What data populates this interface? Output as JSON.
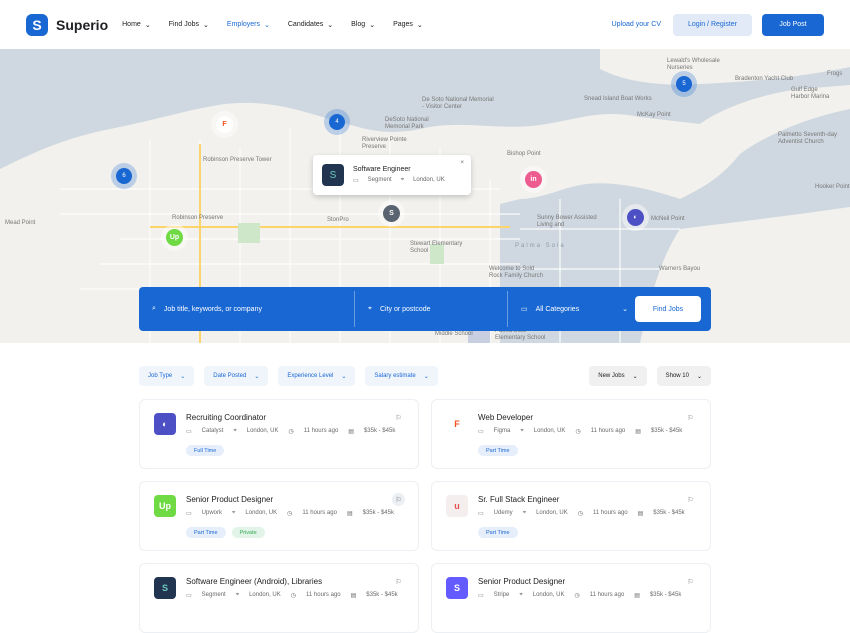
{
  "header": {
    "logo_text": "Superio",
    "nav": [
      "Home",
      "Find Jobs",
      "Employers",
      "Candidates",
      "Blog",
      "Pages"
    ],
    "upload": "Upload your CV",
    "login": "Login / Register",
    "job_post": "Job Post"
  },
  "map": {
    "labels": [
      "Mead Point",
      "Robinson Preserve Tower",
      "Robinson Preserve",
      "De Soto National Memorial - Visitor Center",
      "DeSoto National Memorial Park",
      "Riverview Pointe Preserve",
      "Bishop Point",
      "Sunny Bower Assisted Living and",
      "Palma Sola",
      "Stewart Elementary School",
      "Welcome to Sold Rock Family Church",
      "StonPro",
      "McKay Point",
      "Snead Island Boat Works",
      "Lewald's Wholesale Nurseries",
      "Bradenton Yacht Club",
      "Gulf Edge Harbor Marina",
      "Palmetto Seventh-day Adventist Church",
      "Hooker Point",
      "McNeil Point",
      "Warners Bayou",
      "Middle School",
      "Palma Sola Elementary School",
      "Frogs"
    ],
    "clusters": [
      "6",
      "4",
      "5"
    ],
    "popup": {
      "title": "Software Engineer",
      "company": "Segment",
      "location": "London, UK",
      "close": "×"
    }
  },
  "search": {
    "keyword_placeholder": "Job title, keywords, or company",
    "location_placeholder": "City or postcode",
    "category": "All Categories",
    "button": "Find Jobs"
  },
  "filters": [
    "Job Type",
    "Date Posted",
    "Experience Level",
    "Salary estimate"
  ],
  "sort": [
    "New Jobs",
    "Show 10"
  ],
  "jobs": [
    {
      "title": "Recruiting Coordinator",
      "company": "Catalyst",
      "location": "London, UK",
      "time": "11 hours ago",
      "salary": "$35k - $45k",
      "tags": [
        "Full Time"
      ]
    },
    {
      "title": "Web Developer",
      "company": "Figma",
      "location": "London, UK",
      "time": "11 hours ago",
      "salary": "$35k - $45k",
      "tags": [
        "Part Time"
      ]
    },
    {
      "title": "Senior Product Designer",
      "company": "Upwork",
      "location": "London, UK",
      "time": "11 hours ago",
      "salary": "$35k - $45k",
      "tags": [
        "Part Time",
        "Private"
      ]
    },
    {
      "title": "Sr. Full Stack Engineer",
      "company": "Udemy",
      "location": "London, UK",
      "time": "11 hours ago",
      "salary": "$35k - $45k",
      "tags": [
        "Part Time"
      ]
    },
    {
      "title": "Software Engineer (Android), Libraries",
      "company": "Segment",
      "location": "London, UK",
      "time": "11 hours ago",
      "salary": "$35k - $45k",
      "tags": []
    },
    {
      "title": "Senior Product Designer",
      "company": "Stripe",
      "location": "London, UK",
      "time": "11 hours ago",
      "salary": "$35k - $45k",
      "tags": []
    }
  ],
  "colors": {
    "accent": "#1967d2",
    "catalyst": "#4c50c4",
    "upwork": "#6fda44",
    "udemy": "#f4efee",
    "segment": "#213551",
    "stripe": "#635bff",
    "figma": "#f24e1e"
  },
  "icons": {
    "bookmark": "bookmark-icon",
    "briefcase": "briefcase-icon",
    "location": "location-pin-icon",
    "clock": "clock-icon",
    "money": "money-icon",
    "search": "search-icon",
    "chevron": "chevron-down-icon"
  }
}
